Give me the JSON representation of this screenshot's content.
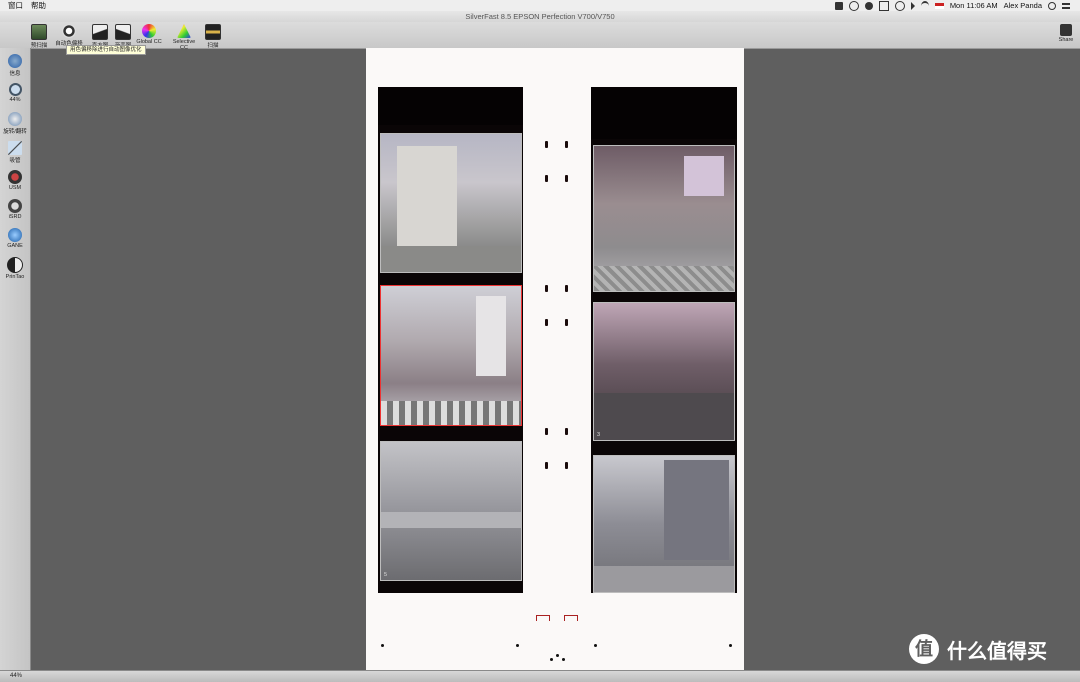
{
  "menubar": {
    "menus": [
      "窗口",
      "帮助"
    ],
    "clock": "Mon 11:06 AM",
    "user": "Alex Panda"
  },
  "window": {
    "title": "SilverFast 8.5 EPSON Perfection V700/V750"
  },
  "toolbar": {
    "buttons": [
      "预扫描",
      "自动色偏移除",
      "直方图",
      "渐变图",
      "Global CC",
      "Selective CC",
      "扫描"
    ],
    "tooltip": "用色偏移除进行自动图像优化",
    "share_label": "Share"
  },
  "left_tools": [
    {
      "label": "信息",
      "icon": "info-icon"
    },
    {
      "label": "44%",
      "icon": "zoom-icon"
    },
    {
      "label": "旋转/翻转",
      "icon": "rotate-icon"
    },
    {
      "label": "吸管",
      "icon": "eyedropper-icon"
    },
    {
      "label": "USM",
      "icon": "usm-icon"
    },
    {
      "label": "iSRD",
      "icon": "isrd-icon"
    },
    {
      "label": "GANE",
      "icon": "gane-icon"
    },
    {
      "label": "PrinTao",
      "icon": "printao-icon"
    }
  ],
  "frames": [
    {
      "number": "",
      "selected": false
    },
    {
      "number": "",
      "selected": false
    },
    {
      "number": "",
      "selected": true
    },
    {
      "number": "3",
      "selected": false
    },
    {
      "number": "5",
      "selected": false
    },
    {
      "number": "",
      "selected": false
    }
  ],
  "status": {
    "zoom": "44%"
  },
  "watermark": {
    "text": "什么值得买",
    "logo_char": "值"
  }
}
